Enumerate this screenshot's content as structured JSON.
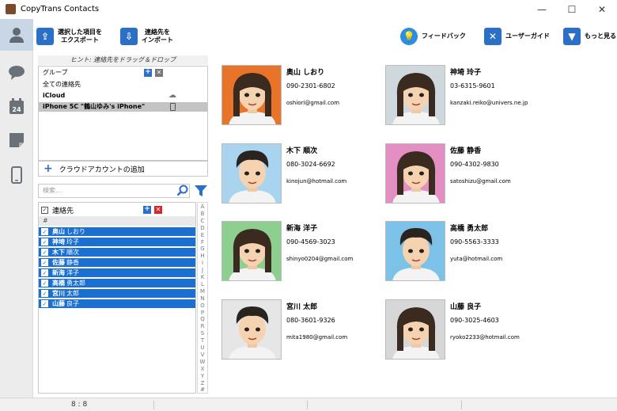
{
  "window": {
    "title": "CopyTrans Contacts",
    "minimize": "—",
    "maximize": "☐",
    "close": "✕"
  },
  "sidebar": [
    {
      "icon": "person-icon",
      "active": true
    },
    {
      "icon": "chat-bubble-icon",
      "active": false
    },
    {
      "icon": "calendar-icon",
      "label": "24",
      "active": false
    },
    {
      "icon": "note-icon",
      "active": false
    },
    {
      "icon": "phone-icon",
      "active": false
    }
  ],
  "toolbar": {
    "export_label": "選択した項目を\nエクスポート",
    "import_label": "連絡先を\nインポート",
    "feedback_label": "フィードバック",
    "guide_label": "ユーザーガイド",
    "more_label": "もっと見る"
  },
  "groups_panel": {
    "hint": "ヒント: 連絡先をドラッグ＆ドロップ",
    "header": "グループ",
    "rows": [
      "全ての連絡先",
      "iCloud",
      "iPhone 5C \"鶴山ゆみ's iPhone\""
    ],
    "add_cloud": "クラウドアカウントの追加"
  },
  "search": {
    "placeholder": "検索..."
  },
  "contact_list": {
    "header": "連絡先",
    "hash": "#",
    "items": [
      {
        "last": "奥山",
        "first": "しおり"
      },
      {
        "last": "神埼",
        "first": "玲子"
      },
      {
        "last": "木下",
        "first": "順次"
      },
      {
        "last": "佐藤",
        "first": "静香"
      },
      {
        "last": "新海",
        "first": "洋子"
      },
      {
        "last": "高橋",
        "first": "勇太郎"
      },
      {
        "last": "宮川",
        "first": "太郎"
      },
      {
        "last": "山藤",
        "first": "良子"
      }
    ],
    "alphabet": [
      "A",
      "B",
      "C",
      "D",
      "E",
      "F",
      "G",
      "H",
      "I",
      "J",
      "K",
      "L",
      "M",
      "N",
      "O",
      "P",
      "Q",
      "R",
      "S",
      "T",
      "U",
      "V",
      "W",
      "X",
      "Y",
      "Z",
      "#"
    ]
  },
  "cards": [
    {
      "name": "奥山 しおり",
      "phone": "090-2301-6802",
      "email": "oshiori@gmail.com",
      "bg": "#e8742a",
      "gender": "f"
    },
    {
      "name": "神埼 玲子",
      "phone": "03-6315-9601",
      "email": "kanzaki.reiko@univers.ne.jp",
      "bg": "#cfd8dc",
      "gender": "f"
    },
    {
      "name": "木下 順次",
      "phone": "080-3024-6692",
      "email": "kinojun@hotmail.com",
      "bg": "#a9d4ef",
      "gender": "m"
    },
    {
      "name": "佐藤 静香",
      "phone": "090-4302-9830",
      "email": "satoshizu@gmail.com",
      "bg": "#e38fc4",
      "gender": "f"
    },
    {
      "name": "新海 洋子",
      "phone": "090-4569-3023",
      "email": "shinyo0204@gmail.com",
      "bg": "#8ccf8f",
      "gender": "f"
    },
    {
      "name": "高橋 勇太郎",
      "phone": "090-5563-3333",
      "email": "yuta@hotmail.com",
      "bg": "#7cc1e8",
      "gender": "m"
    },
    {
      "name": "宮川 太郎",
      "phone": "080-3601-9326",
      "email": "mita1980@gmail.com",
      "bg": "#e6e6e6",
      "gender": "m"
    },
    {
      "name": "山藤 良子",
      "phone": "090-3025-4603",
      "email": "ryoko2233@hotmail.com",
      "bg": "#d7d7d7",
      "gender": "f"
    }
  ],
  "status": {
    "count": "8 : 8"
  }
}
